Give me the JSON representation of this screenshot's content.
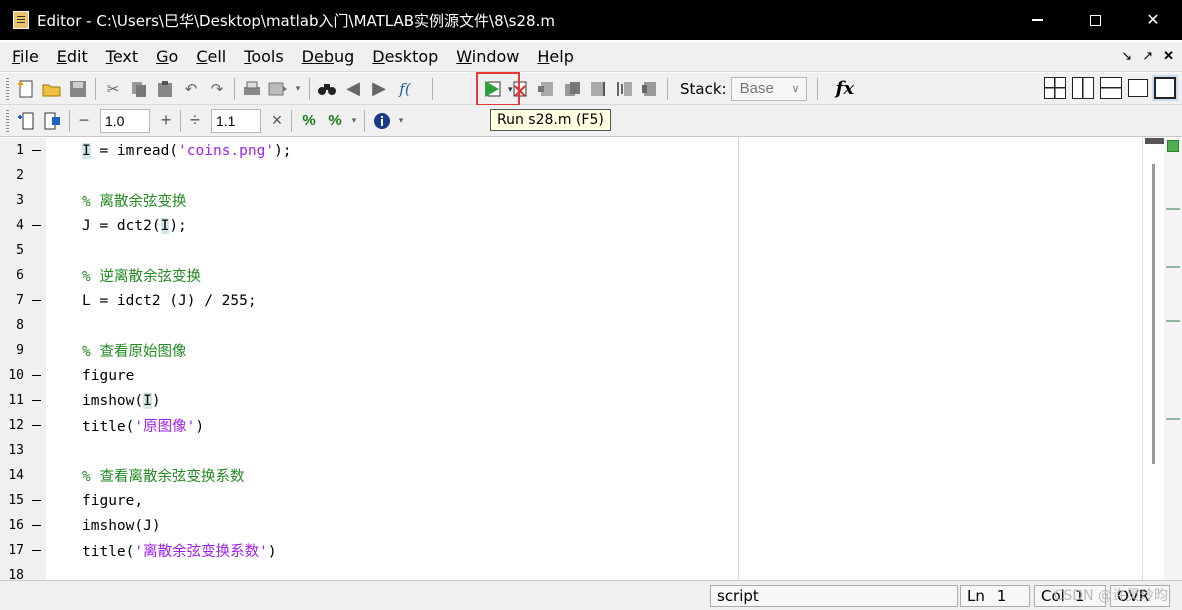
{
  "window": {
    "title": "Editor - C:\\Users\\巳华\\Desktop\\matlab入门\\MATLAB实例源文件\\8\\s28.m",
    "minimize": "—",
    "close": "✕"
  },
  "menu": {
    "items": [
      {
        "first": "F",
        "rest": "ile"
      },
      {
        "first": "E",
        "rest": "dit"
      },
      {
        "first": "T",
        "rest": "ext"
      },
      {
        "first": "G",
        "rest": "o"
      },
      {
        "first": "C",
        "rest": "ell"
      },
      {
        "first": "T",
        "rest": "ools"
      },
      {
        "first": "Deb",
        "rest": "ug"
      },
      {
        "first": "D",
        "rest": "esktop"
      },
      {
        "first": "W",
        "rest": "indow"
      },
      {
        "first": "H",
        "rest": "elp"
      }
    ],
    "right_icons": [
      "↘",
      "↗",
      "✕"
    ]
  },
  "toolbar": {
    "stack_label": "Stack:",
    "stack_value": "Base",
    "fx_label": "fx",
    "cell_minus": "−",
    "cell_value_1": "1.0",
    "cell_plus": "+",
    "cell_divide": "÷",
    "cell_value_2": "1.1",
    "cell_times": "×"
  },
  "tooltip": "Run s28.m (F5)",
  "editor": {
    "lines": [
      {
        "n": "1",
        "exec": true,
        "parts": [
          {
            "t": "I",
            "c": "hl"
          },
          {
            "t": " = imread("
          },
          {
            "t": "'coins.png'",
            "c": "c-string"
          },
          {
            "t": ");"
          }
        ]
      },
      {
        "n": "2",
        "exec": false,
        "parts": []
      },
      {
        "n": "3",
        "exec": false,
        "parts": [
          {
            "t": "% 离散余弦变换",
            "c": "c-comment"
          }
        ]
      },
      {
        "n": "4",
        "exec": true,
        "parts": [
          {
            "t": "J = dct2("
          },
          {
            "t": "I",
            "c": "hl"
          },
          {
            "t": ");"
          }
        ]
      },
      {
        "n": "5",
        "exec": false,
        "parts": []
      },
      {
        "n": "6",
        "exec": false,
        "parts": [
          {
            "t": "% 逆离散余弦变换",
            "c": "c-comment"
          }
        ]
      },
      {
        "n": "7",
        "exec": true,
        "parts": [
          {
            "t": "L = idct2 (J) / 255;"
          }
        ]
      },
      {
        "n": "8",
        "exec": false,
        "parts": []
      },
      {
        "n": "9",
        "exec": false,
        "parts": [
          {
            "t": "% 查看原始图像",
            "c": "c-comment"
          }
        ]
      },
      {
        "n": "10",
        "exec": true,
        "parts": [
          {
            "t": "figure"
          }
        ]
      },
      {
        "n": "11",
        "exec": true,
        "parts": [
          {
            "t": "imshow("
          },
          {
            "t": "I",
            "c": "hl"
          },
          {
            "t": ")"
          }
        ]
      },
      {
        "n": "12",
        "exec": true,
        "parts": [
          {
            "t": "title("
          },
          {
            "t": "'原图像'",
            "c": "c-string"
          },
          {
            "t": ")"
          }
        ]
      },
      {
        "n": "13",
        "exec": false,
        "parts": []
      },
      {
        "n": "14",
        "exec": false,
        "parts": [
          {
            "t": "% 查看离散余弦变换系数",
            "c": "c-comment"
          }
        ]
      },
      {
        "n": "15",
        "exec": true,
        "parts": [
          {
            "t": "figure,"
          }
        ]
      },
      {
        "n": "16",
        "exec": true,
        "parts": [
          {
            "t": "imshow(J)"
          }
        ]
      },
      {
        "n": "17",
        "exec": true,
        "parts": [
          {
            "t": "title("
          },
          {
            "t": "'离散余弦变换系数'",
            "c": "c-string"
          },
          {
            "t": ")"
          }
        ]
      },
      {
        "n": "18",
        "exec": false,
        "parts": []
      }
    ]
  },
  "status": {
    "mode": "script",
    "ln_label": "Ln",
    "ln_value": "1",
    "col_label": "Col",
    "col_value": "1",
    "ovr": "OVR"
  },
  "watermark": "CSDN @许灵玲昀"
}
